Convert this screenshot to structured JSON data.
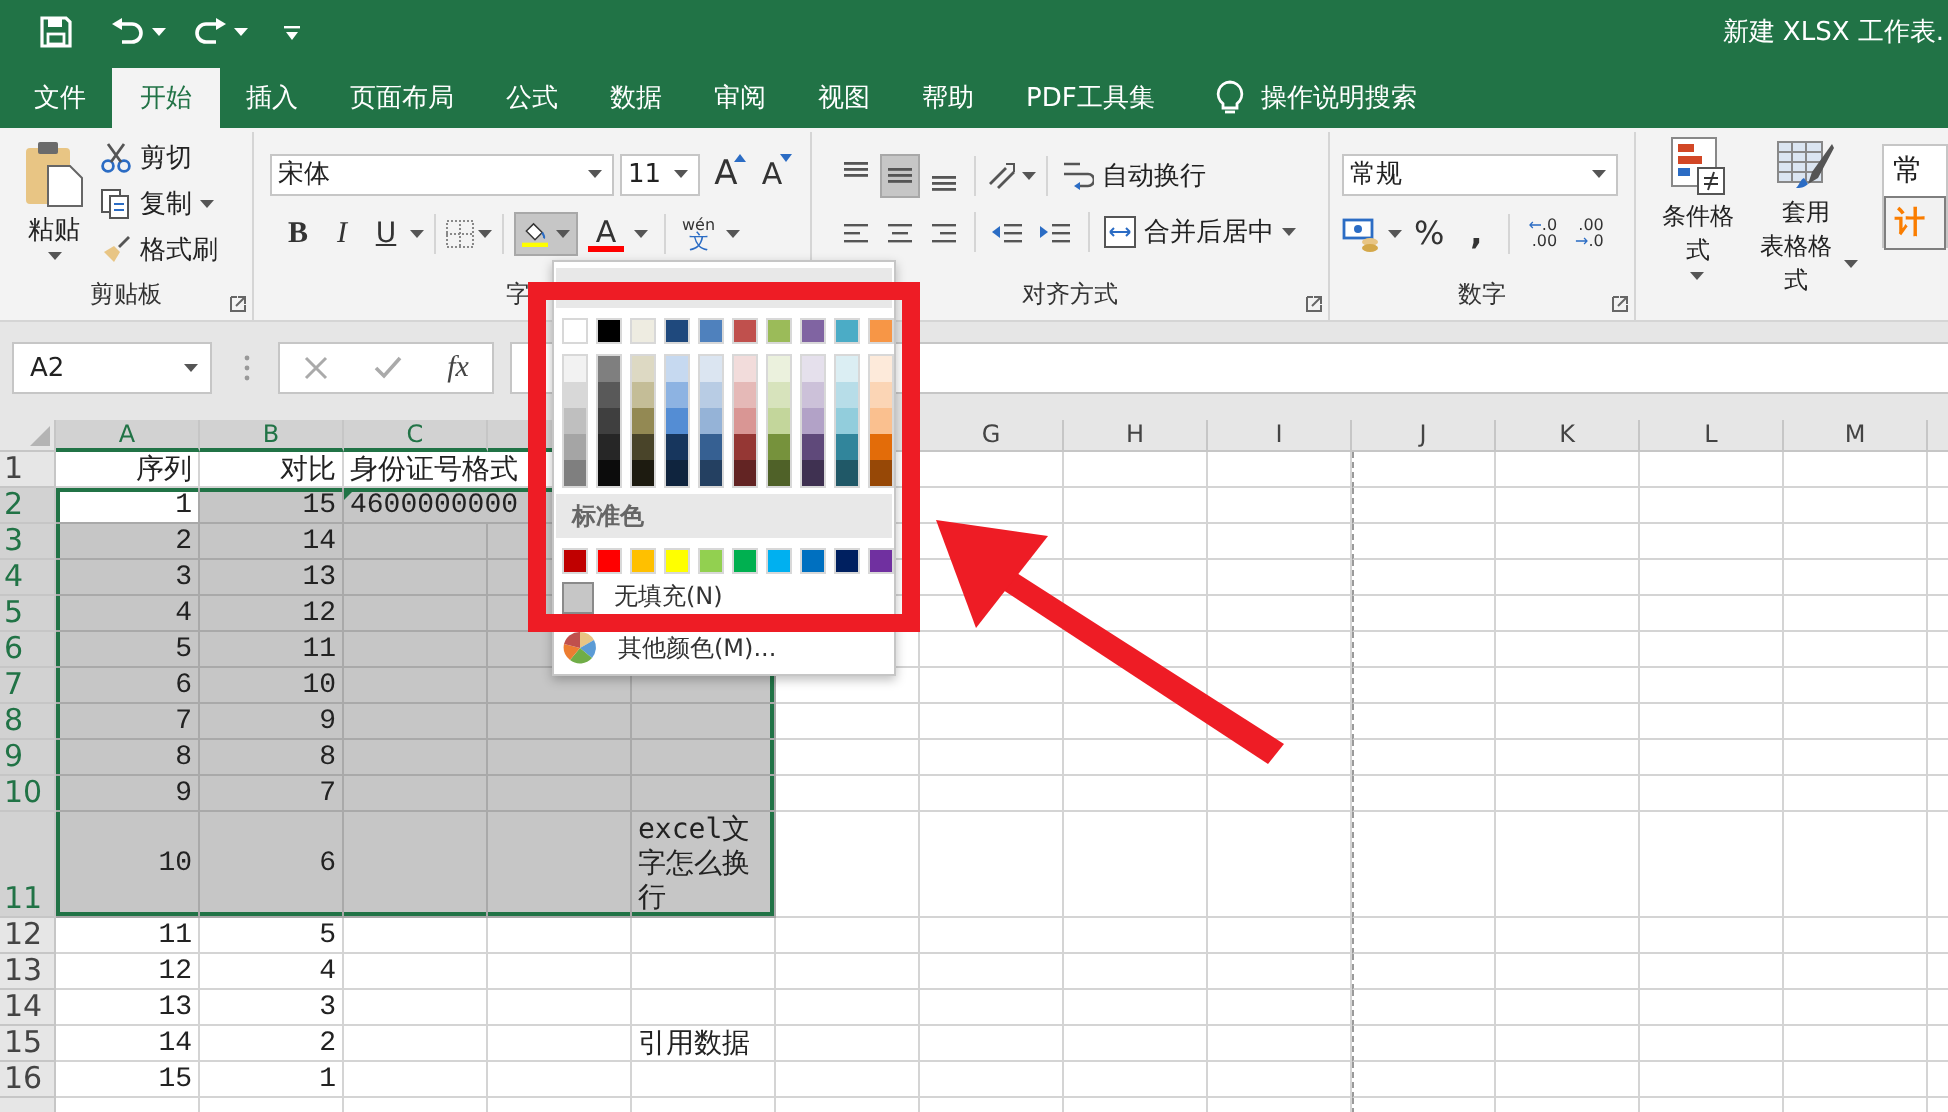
{
  "window": {
    "title": "新建 XLSX 工作表."
  },
  "tabs": [
    {
      "label": "文件",
      "selected": false
    },
    {
      "label": "开始",
      "selected": true
    },
    {
      "label": "插入",
      "selected": false
    },
    {
      "label": "页面布局",
      "selected": false
    },
    {
      "label": "公式",
      "selected": false
    },
    {
      "label": "数据",
      "selected": false
    },
    {
      "label": "审阅",
      "selected": false
    },
    {
      "label": "视图",
      "selected": false
    },
    {
      "label": "帮助",
      "selected": false
    },
    {
      "label": "PDF工具集",
      "selected": false
    }
  ],
  "tell_me": "操作说明搜索",
  "clipboard": {
    "paste": "粘贴",
    "cut": "剪切",
    "copy": "复制",
    "format_painter": "格式刷",
    "label": "剪贴板"
  },
  "font": {
    "name": "宋体",
    "size": "11",
    "grow": "A",
    "shrink": "A",
    "bold": "B",
    "italic": "I",
    "underline": "U",
    "fill_pressed": true,
    "font_color": "A",
    "phonetic_top": "wén",
    "phonetic_bottom": "文",
    "label": "字"
  },
  "alignment": {
    "vertical": [
      {
        "selected": false
      },
      {
        "selected": true
      },
      {
        "selected": false
      }
    ],
    "wrap_text": "自动换行",
    "merge": "合并后居中",
    "label": "对齐方式"
  },
  "number": {
    "format": "常规",
    "percent": "%",
    "comma": ",",
    "increase_decimal": {
      "arrow": "←",
      "top": ".0",
      "bottom": ".00"
    },
    "decrease_decimal": {
      "arrow": "→",
      "top": ".00",
      "bottom": ".0"
    },
    "label": "数字"
  },
  "styles": {
    "conditional": "条件格式",
    "table_format": [
      "套用",
      "表格格式"
    ],
    "cell_styles": [
      {
        "text": "常",
        "kind": "normal"
      },
      {
        "text": "计",
        "kind": "calc"
      }
    ]
  },
  "formula_bar": {
    "name_box": "A2",
    "function_symbol": "fx"
  },
  "columns_left": [
    {
      "label": "A",
      "selected": true
    },
    {
      "label": "B",
      "selected": true
    },
    {
      "label": "C",
      "selected": true
    },
    {
      "selected": true
    }
  ],
  "columns_right": [
    {
      "label": "G",
      "selected": false
    },
    {
      "label": "H",
      "selected": false
    },
    {
      "label": "I",
      "selected": false
    },
    {
      "label": "J",
      "selected": false
    },
    {
      "label": "K",
      "selected": false
    },
    {
      "label": "L",
      "selected": false
    },
    {
      "label": "M",
      "selected": false
    }
  ],
  "rows": [
    {
      "number": "1",
      "selected": false,
      "a": "序列",
      "b": "对比",
      "c": "身份证号格式"
    },
    {
      "number": "2",
      "selected": true,
      "active": true,
      "a": "1",
      "b": "15",
      "c": "4600000000"
    },
    {
      "number": "3",
      "selected": true,
      "a": "2",
      "b": "14"
    },
    {
      "number": "4",
      "selected": true,
      "a": "3",
      "b": "13"
    },
    {
      "number": "5",
      "selected": true,
      "a": "4",
      "b": "12"
    },
    {
      "number": "6",
      "selected": true,
      "a": "5",
      "b": "11"
    },
    {
      "number": "7",
      "selected": true,
      "a": "6",
      "b": "10"
    },
    {
      "number": "8",
      "selected": true,
      "a": "7",
      "b": "9"
    },
    {
      "number": "9",
      "selected": true,
      "a": "8",
      "b": "8"
    },
    {
      "number": "10",
      "selected": true,
      "a": "9",
      "b": "7"
    },
    {
      "number": "11",
      "selected": true,
      "tall": true,
      "a": "10",
      "b": "6",
      "e": "excel文字怎么换行"
    },
    {
      "number": "12",
      "selected": false,
      "a": "11",
      "b": "5"
    },
    {
      "number": "13",
      "selected": false,
      "a": "12",
      "b": "4"
    },
    {
      "number": "14",
      "selected": false,
      "a": "13",
      "b": "3"
    },
    {
      "number": "15",
      "selected": false,
      "a": "14",
      "b": "2",
      "e": "引用数据"
    },
    {
      "number": "16",
      "selected": false,
      "a": "15",
      "b": "1"
    }
  ],
  "fill_palette": {
    "theme": [
      {
        "color": "#ffffff",
        "shades": [
          {
            "color": "#f2f2f2"
          },
          {
            "color": "#d8d8d8"
          },
          {
            "color": "#bfbfbf"
          },
          {
            "color": "#a5a5a5"
          },
          {
            "color": "#7f7f7f"
          }
        ]
      },
      {
        "color": "#000000",
        "shades": [
          {
            "color": "#7f7f7f"
          },
          {
            "color": "#595959"
          },
          {
            "color": "#3f3f3f"
          },
          {
            "color": "#262626"
          },
          {
            "color": "#0c0c0c"
          }
        ]
      },
      {
        "color": "#eeece1",
        "shades": [
          {
            "color": "#ddd9c3"
          },
          {
            "color": "#c4bd97"
          },
          {
            "color": "#938953"
          },
          {
            "color": "#494429"
          },
          {
            "color": "#1d1b10"
          }
        ]
      },
      {
        "color": "#1f497d",
        "shades": [
          {
            "color": "#c6d9f0"
          },
          {
            "color": "#8db3e2"
          },
          {
            "color": "#548dd4"
          },
          {
            "color": "#17365d"
          },
          {
            "color": "#0f243e"
          }
        ]
      },
      {
        "color": "#4f81bd",
        "shades": [
          {
            "color": "#dbe5f1"
          },
          {
            "color": "#b8cce4"
          },
          {
            "color": "#95b3d7"
          },
          {
            "color": "#366092"
          },
          {
            "color": "#244061"
          }
        ]
      },
      {
        "color": "#c0504d",
        "shades": [
          {
            "color": "#f2dcdb"
          },
          {
            "color": "#e5b9b7"
          },
          {
            "color": "#d99694"
          },
          {
            "color": "#953734"
          },
          {
            "color": "#632423"
          }
        ]
      },
      {
        "color": "#9bbb59",
        "shades": [
          {
            "color": "#ebf1dd"
          },
          {
            "color": "#d7e3bc"
          },
          {
            "color": "#c3d69b"
          },
          {
            "color": "#76923c"
          },
          {
            "color": "#4f6128"
          }
        ]
      },
      {
        "color": "#8064a2",
        "shades": [
          {
            "color": "#e5e0ec"
          },
          {
            "color": "#ccc1d9"
          },
          {
            "color": "#b2a2c7"
          },
          {
            "color": "#5f497a"
          },
          {
            "color": "#3f3151"
          }
        ]
      },
      {
        "color": "#4bacc6",
        "shades": [
          {
            "color": "#dbeef3"
          },
          {
            "color": "#b7dde8"
          },
          {
            "color": "#92cddc"
          },
          {
            "color": "#31859b"
          },
          {
            "color": "#205867"
          }
        ]
      },
      {
        "color": "#f79646",
        "shades": [
          {
            "color": "#fdeada"
          },
          {
            "color": "#fbd5b5"
          },
          {
            "color": "#fac08f"
          },
          {
            "color": "#e36c09"
          },
          {
            "color": "#974806"
          }
        ]
      }
    ],
    "standard_title": "标准色",
    "standard": [
      {
        "color": "#c00000"
      },
      {
        "color": "#ff0000"
      },
      {
        "color": "#ffc000"
      },
      {
        "color": "#ffff00"
      },
      {
        "color": "#92d050"
      },
      {
        "color": "#00b050"
      },
      {
        "color": "#00b0f0"
      },
      {
        "color": "#0070c0"
      },
      {
        "color": "#002060"
      },
      {
        "color": "#7030a0"
      }
    ],
    "no_fill": "无填充(N)",
    "more_colors": "其他颜色(M)..."
  }
}
